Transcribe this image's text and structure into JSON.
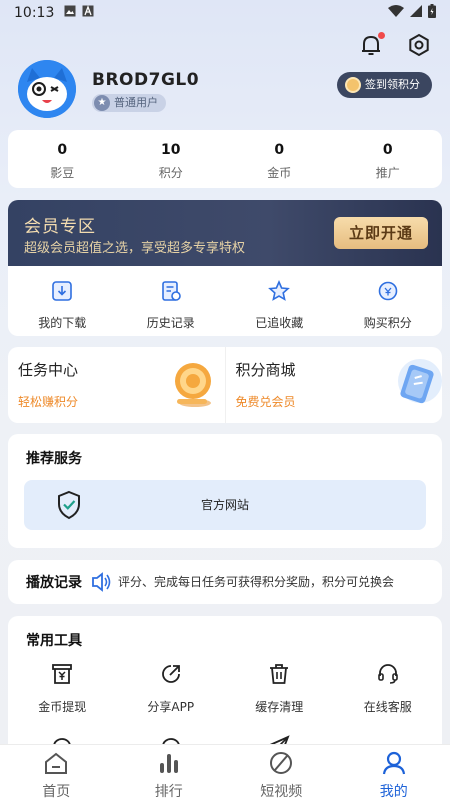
{
  "status_bar": {
    "time": "10:13"
  },
  "profile": {
    "username": "BROD7GL0",
    "badge": "普通用户",
    "checkin_label": "签到领积分"
  },
  "stats": [
    {
      "value": "0",
      "label": "影豆"
    },
    {
      "value": "10",
      "label": "积分"
    },
    {
      "value": "0",
      "label": "金币"
    },
    {
      "value": "0",
      "label": "推广"
    }
  ],
  "vip": {
    "title": "会员专区",
    "subtitle": "超级会员超值之选，享受超多专享特权",
    "button": "立即开通"
  },
  "quick_actions": [
    {
      "label": "我的下载",
      "icon": "download-icon"
    },
    {
      "label": "历史记录",
      "icon": "history-icon"
    },
    {
      "label": "已追收藏",
      "icon": "star-icon"
    },
    {
      "label": "购买积分",
      "icon": "points-icon"
    }
  ],
  "task_center": {
    "title": "任务中心",
    "subtitle": "轻松赚积分"
  },
  "points_mall": {
    "title": "积分商城",
    "subtitle": "免费兑会员"
  },
  "recommend": {
    "title": "推荐服务",
    "official_site": "官方网站"
  },
  "playback": {
    "title": "播放记录",
    "marquee": "幕、评分、完成每日任务可获得积分奖励，积分可兑换会"
  },
  "tools": {
    "title": "常用工具",
    "items": [
      {
        "label": "金币提现",
        "icon": "withdraw-icon"
      },
      {
        "label": "分享APP",
        "icon": "share-icon"
      },
      {
        "label": "缓存清理",
        "icon": "trash-icon"
      },
      {
        "label": "在线客服",
        "icon": "headset-icon"
      }
    ]
  },
  "tabbar": [
    {
      "label": "首页",
      "icon": "home-icon"
    },
    {
      "label": "排行",
      "icon": "ranking-icon"
    },
    {
      "label": "短视频",
      "icon": "short-video-icon"
    },
    {
      "label": "我的",
      "icon": "profile-icon",
      "active": true
    }
  ],
  "colors": {
    "accent": "#1d62d8",
    "vip_gold": "#f3dcb0",
    "orange": "#ee8a2a"
  }
}
